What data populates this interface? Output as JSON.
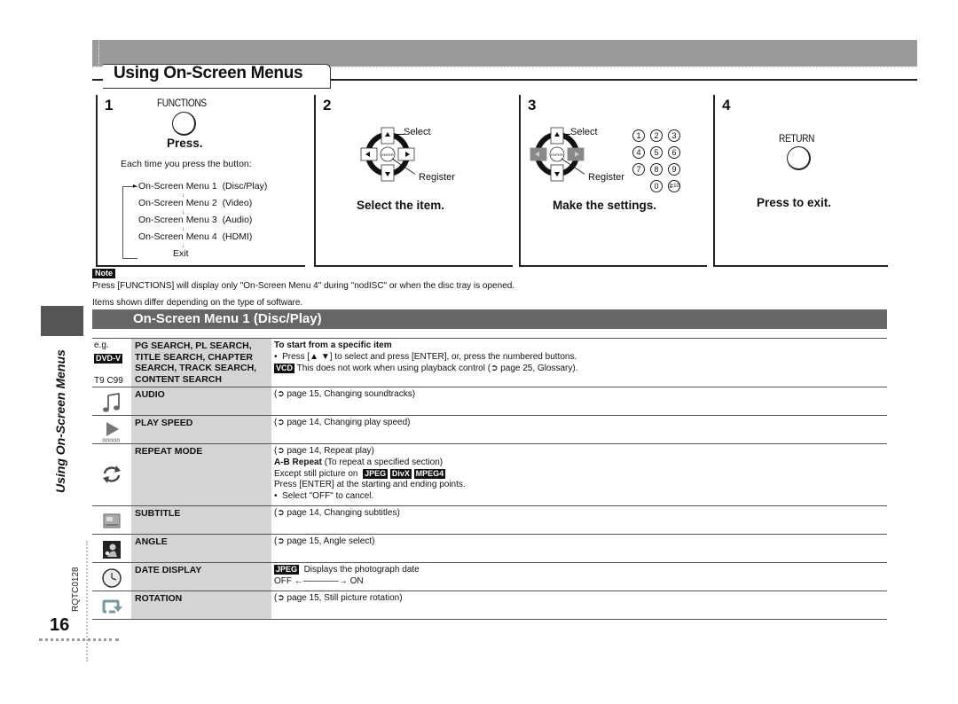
{
  "header": {
    "title": "Using On-Screen Menus"
  },
  "steps": [
    {
      "number": "1",
      "button_label": "FUNCTIONS",
      "caption": "Press.",
      "intro": "Each time you press the button:",
      "sequence": [
        {
          "menu": "On-Screen Menu 1",
          "detail": "(Disc/Play)"
        },
        {
          "menu": "On-Screen Menu 2",
          "detail": "(Video)"
        },
        {
          "menu": "On-Screen Menu 3",
          "detail": "(Audio)"
        },
        {
          "menu": "On-Screen Menu 4",
          "detail": "(HDMI)"
        }
      ],
      "exit_label": "Exit"
    },
    {
      "number": "2",
      "select_label": "Select",
      "register_label": "Register",
      "enter_label": "ENTER",
      "caption": "Select the item."
    },
    {
      "number": "3",
      "select_label": "Select",
      "register_label": "Register",
      "enter_label": "ENTER",
      "numpad": [
        "1",
        "2",
        "3",
        "4",
        "5",
        "6",
        "7",
        "8",
        "9",
        "0",
        "≧10"
      ],
      "caption": "Make the settings."
    },
    {
      "number": "4",
      "button_label": "RETURN",
      "caption": "Press to exit."
    }
  ],
  "note": {
    "tag": "Note",
    "text": "Press [FUNCTIONS] will display only \"On-Screen Menu 4\" during \"nodISC\" or when the disc tray is opened.",
    "items_text": "Items shown differ depending on the type of software."
  },
  "section": {
    "title": "On-Screen Menu 1 (Disc/Play)"
  },
  "side": {
    "title": "Using On-Screen Menus",
    "code": "RQTC0128",
    "page": "16"
  },
  "table": {
    "rows": [
      {
        "icon": "dvd-v-badge",
        "eg": "e.g.",
        "badge": "DVD-V",
        "example": "T9  C99",
        "name": "PG SEARCH, PL SEARCH, TITLE SEARCH, CHAPTER SEARCH, TRACK SEARCH, CONTENT SEARCH",
        "name_lines": [
          "PG SEARCH, PL SEARCH,",
          "TITLE SEARCH, CHAPTER",
          "SEARCH, TRACK SEARCH,",
          "CONTENT SEARCH"
        ],
        "desc_title": "To start from a specific item",
        "desc_bullet": "Press [▲ ▼] to select and press [ENTER], or, press the numbered buttons.",
        "desc_tag": "VCD",
        "desc_note": "This does not work when using playback control (➲ page 25, Glossary)."
      },
      {
        "icon": "music-note-icon",
        "name": "AUDIO",
        "desc": "(➲ page 15, Changing soundtracks)"
      },
      {
        "icon": "play-speed-icon",
        "name": "PLAY SPEED",
        "desc": "(➲ page 14, Changing play speed)"
      },
      {
        "icon": "repeat-icon",
        "name": "REPEAT MODE",
        "desc": "(➲ page 14, Repeat play)",
        "ab_title": "A-B Repeat",
        "ab_detail": "(To repeat a specified section)",
        "except_text": "Except still picture on",
        "except_tags": [
          "JPEG",
          "DivX",
          "MPEG4"
        ],
        "press_text": "Press [ENTER] at the starting and ending points.",
        "cancel_text": "Select \"OFF\" to cancel."
      },
      {
        "icon": "subtitle-icon",
        "name": "SUBTITLE",
        "desc": "(➲ page 14, Changing subtitles)"
      },
      {
        "icon": "angle-icon",
        "name": "ANGLE",
        "desc": "(➲ page 15, Angle select)"
      },
      {
        "icon": "clock-icon",
        "name": "DATE DISPLAY",
        "desc_tag": "JPEG",
        "desc": "Displays the photograph date",
        "off": "OFF",
        "on": "ON"
      },
      {
        "icon": "rotation-icon",
        "name": "ROTATION",
        "desc": "(➲ page 15, Still picture rotation)"
      }
    ]
  }
}
